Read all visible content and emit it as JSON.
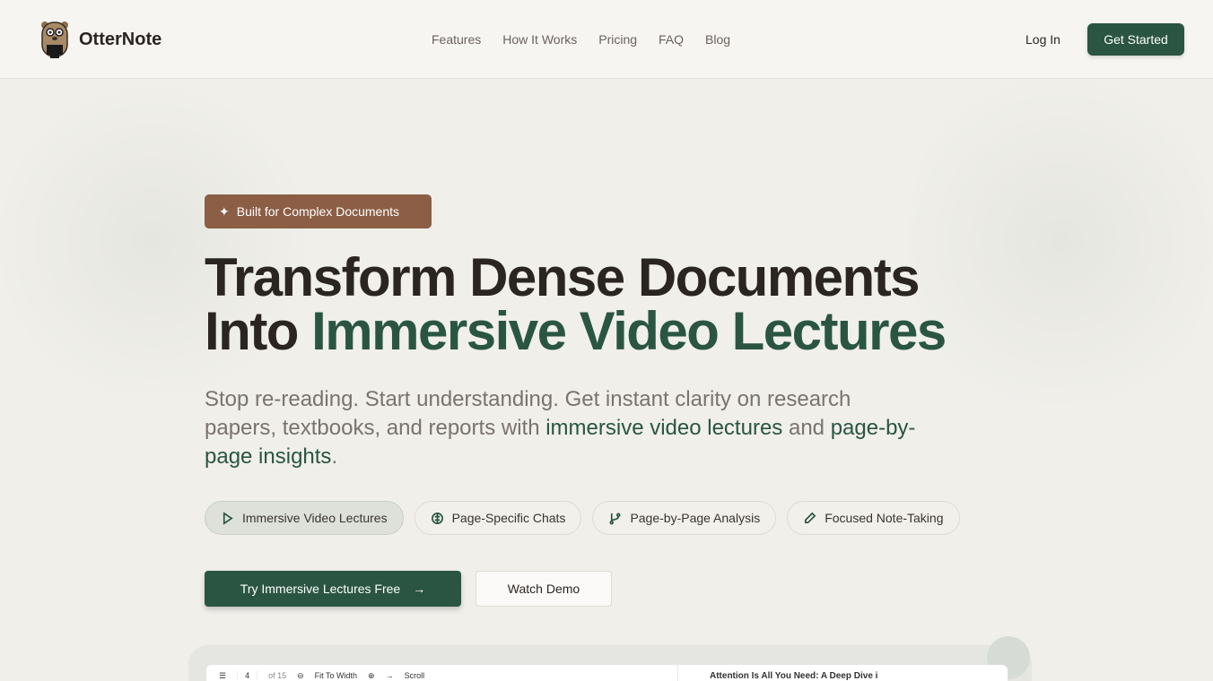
{
  "header": {
    "brand": "OtterNote",
    "nav": [
      "Features",
      "How It Works",
      "Pricing",
      "FAQ",
      "Blog"
    ],
    "login": "Log In",
    "get_started": "Get Started"
  },
  "hero": {
    "badge": "Built for Complex Documents",
    "title_line1": "Transform Dense Documents",
    "title_into": "Into ",
    "title_highlight": "Immersive Video Lectures",
    "sub_1": "Stop re-reading. Start understanding. Get instant clarity on research papers, textbooks, and reports with ",
    "sub_h1": "immersive video lectures",
    "sub_2": " and ",
    "sub_h2": "page-by-page insights",
    "sub_3": ".",
    "chips": [
      "Immersive Video Lectures",
      "Page-Specific Chats",
      "Page-by-Page Analysis",
      "Focused Note-Taking"
    ],
    "cta": "Try Immersive Lectures Free",
    "demo": "Watch Demo"
  },
  "preview": {
    "page": "4",
    "of": "of 15",
    "fit": "Fit To Width",
    "scroll": "Scroll",
    "doc_title": "Attention Is All You Need: A Deep Dive i"
  },
  "colors": {
    "accent": "#2a5542",
    "badge": "#8b5e45"
  }
}
